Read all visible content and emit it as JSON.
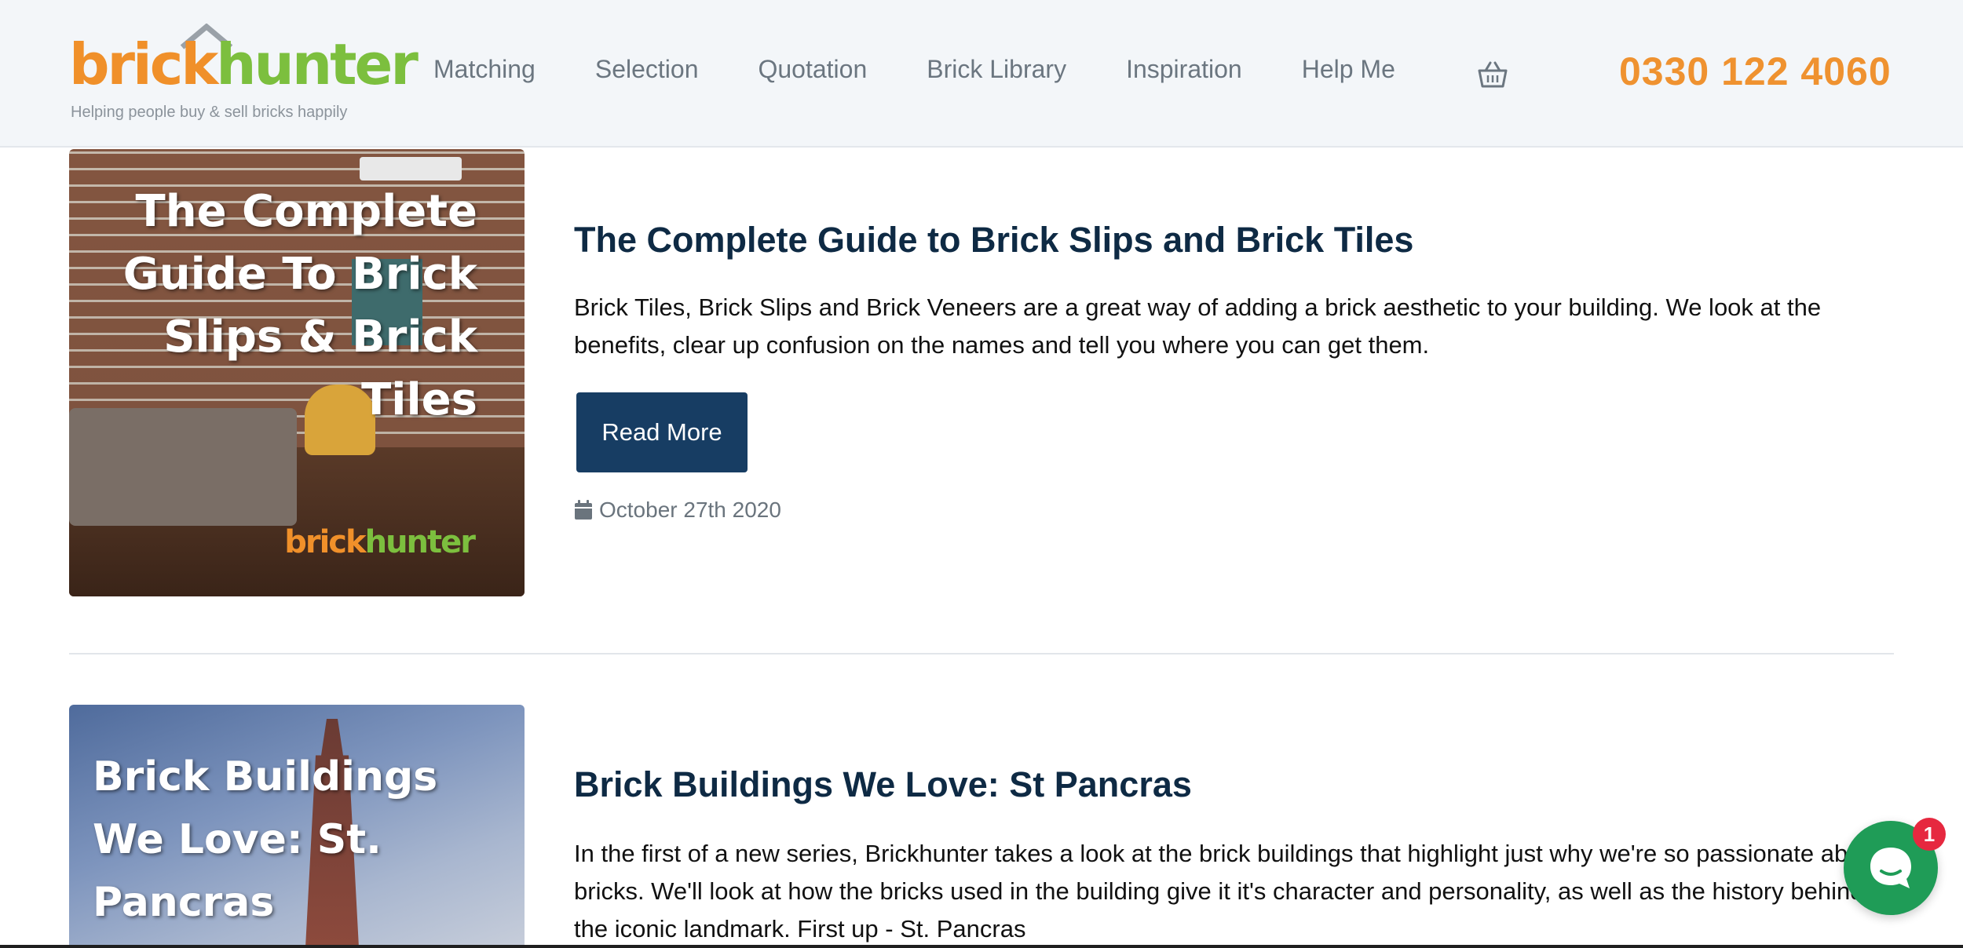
{
  "header": {
    "logo": {
      "word_b": "b",
      "word_rick": "rick",
      "word_hunter": "hunter",
      "tagline": "Helping people buy & sell bricks happily"
    },
    "nav": [
      "Matching",
      "Selection",
      "Quotation",
      "Brick Library",
      "Inspiration",
      "Help Me"
    ],
    "cart_icon": "basket-icon",
    "phone": "0330 122 4060"
  },
  "articles": [
    {
      "thumb_title": "The Complete Guide To Brick Slips & Brick Tiles",
      "thumb_logo_o": "b",
      "thumb_logo_a": "rick",
      "thumb_logo_b": "hunter",
      "title": "The Complete Guide to Brick Slips and Brick Tiles",
      "excerpt": "Brick Tiles, Brick Slips and Brick Veneers are a great way of adding a brick aesthetic to your building. We look at the benefits, clear up confusion on the names and tell you where you can get them.",
      "button": "Read More",
      "date": "October 27th 2020"
    },
    {
      "thumb_title": "Brick Buildings We Love: St. Pancras",
      "title": "Brick Buildings We Love: St Pancras",
      "excerpt": "In the first of a new series, Brickhunter takes a look at the brick buildings that highlight just why we're so passionate about bricks. We'll look at how the bricks used in the building give it it's character and personality, as well as the history behind the iconic landmark. First up - St. Pancras"
    }
  ],
  "chat": {
    "badge": "1"
  },
  "colors": {
    "brand_orange": "#ef9230",
    "brand_green": "#7cbf3e",
    "title_navy": "#0e2a44",
    "button_navy": "#173d63",
    "chat_green": "#1f9c57",
    "badge_red": "#e6283f"
  }
}
